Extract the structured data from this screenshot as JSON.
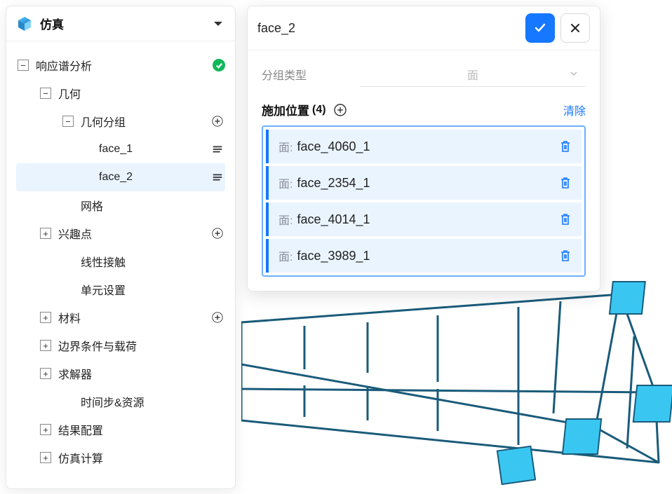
{
  "header": {
    "title": "仿真"
  },
  "tree": {
    "root": {
      "label": "响应谱分析",
      "status": "ok"
    },
    "n_geom": {
      "label": "几何"
    },
    "n_group": {
      "label": "几何分组"
    },
    "face1": {
      "label": "face_1"
    },
    "face2": {
      "label": "face_2"
    },
    "mesh": {
      "label": "网格"
    },
    "poi": {
      "label": "兴趣点"
    },
    "lin": {
      "label": "线性接触"
    },
    "elem": {
      "label": "单元设置"
    },
    "mat": {
      "label": "材料"
    },
    "bcl": {
      "label": "边界条件与载荷"
    },
    "solv": {
      "label": "求解器"
    },
    "tstep": {
      "label": "时间步&资源"
    },
    "res": {
      "label": "结果配置"
    },
    "sim": {
      "label": "仿真计算"
    }
  },
  "panel": {
    "title": "face_2",
    "group_type_label": "分组类型",
    "group_type_value": "面",
    "apply_label": "施加位置",
    "apply_count": "(4)",
    "clear_label": "清除",
    "face_type_label": "面:",
    "items": [
      {
        "name": "face_4060_1"
      },
      {
        "name": "face_2354_1"
      },
      {
        "name": "face_4014_1"
      },
      {
        "name": "face_3989_1"
      }
    ]
  }
}
